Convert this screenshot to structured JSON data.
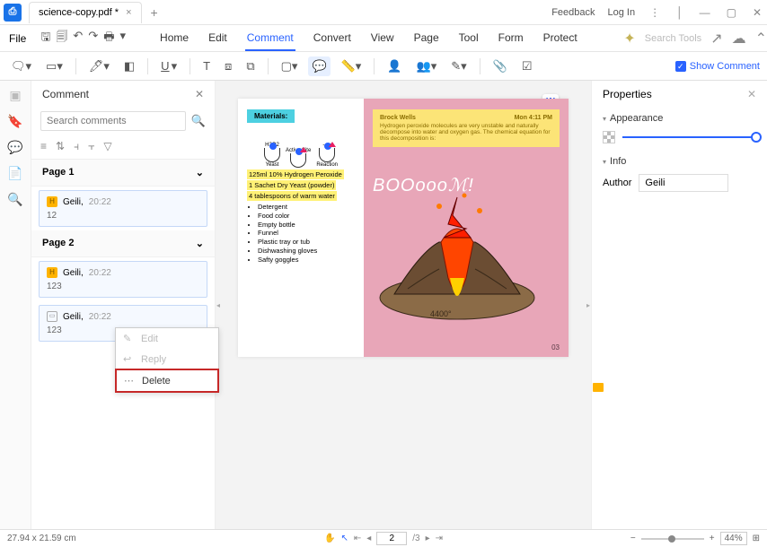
{
  "titlebar": {
    "filename": "science-copy.pdf *",
    "feedback": "Feedback",
    "login": "Log In"
  },
  "menubar": {
    "file": "File",
    "tabs": [
      "Home",
      "Edit",
      "Comment",
      "Convert",
      "View",
      "Page",
      "Tool",
      "Form",
      "Protect"
    ],
    "active": "Comment",
    "search_ph": "Search Tools"
  },
  "toolbar": {
    "show_comment": "Show Comment"
  },
  "comment_panel": {
    "title": "Comment",
    "search_ph": "Search comments",
    "page1": {
      "label": "Page 1",
      "items": [
        {
          "author": "Geili,",
          "time": "20:22",
          "text": "12"
        }
      ]
    },
    "page2": {
      "label": "Page 2",
      "items": [
        {
          "author": "Geili,",
          "time": "20:22",
          "text": "123"
        },
        {
          "author": "Geili,",
          "time": "20:22",
          "text": "123"
        }
      ]
    }
  },
  "context_menu": {
    "edit": "Edit",
    "reply": "Reply",
    "delete": "Delete"
  },
  "document": {
    "materials_title": "Materials:",
    "mols": [
      "H2O2",
      "Active Site",
      "--->"
    ],
    "mlabels": [
      "Yeast",
      "",
      "Reaction"
    ],
    "hl1": "125ml 10% Hydrogen Peroxide",
    "hl2": "1 Sachet Dry Yeast (powder)",
    "hl3": "4 tablespoons of warm water",
    "list": [
      "Detergent",
      "Food color",
      "Empty bottle",
      "Funnel",
      "Plastic tray or tub",
      "Dishwashing gloves",
      "Safty goggles"
    ],
    "boom": "BOOoooℳ!",
    "sticky": {
      "author": "Brock Wells",
      "time": "Mon 4:11 PM",
      "body": "Hydrogen peroxide molecules are very unstable and naturally decompose into water and oxygen gas. The chemical equation for this decomposition is:"
    },
    "pgnum": "03",
    "temp": "4400°"
  },
  "properties": {
    "title": "Properties",
    "appearance": "Appearance",
    "info": "Info",
    "author_label": "Author",
    "author_value": "Geili"
  },
  "statusbar": {
    "dims": "27.94 x 21.59 cm",
    "page": "2",
    "pages": "/3",
    "zoom": "44%"
  }
}
